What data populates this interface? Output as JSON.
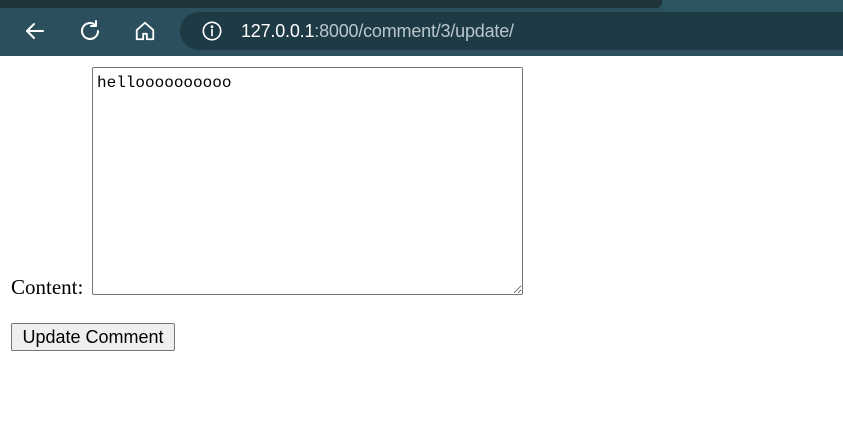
{
  "browser": {
    "url_host": "127.0.0.1",
    "url_path": ":8000/comment/3/update/",
    "back_icon": "back-arrow-icon",
    "reload_icon": "reload-icon",
    "home_icon": "home-icon",
    "info_icon": "info-icon"
  },
  "form": {
    "content_label": "Content:",
    "content_value": "helloooooooooo",
    "submit_label": "Update Comment"
  },
  "colors": {
    "toolbar": "#2b4f5c",
    "address_bar": "#1e3a44"
  }
}
